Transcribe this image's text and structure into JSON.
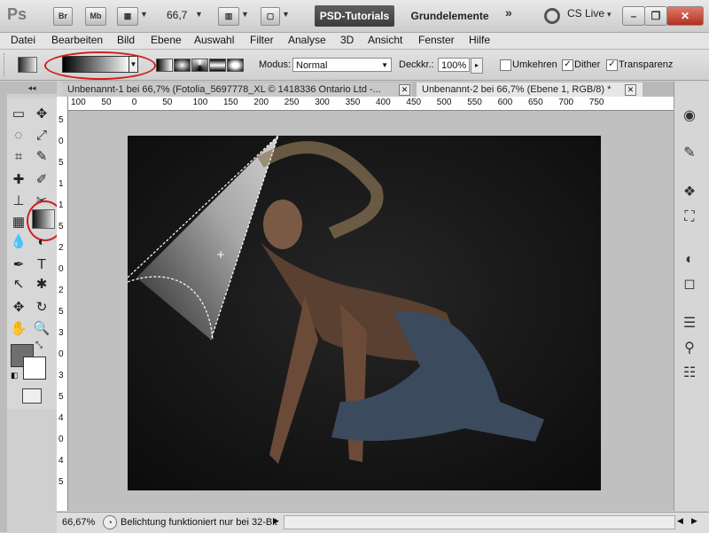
{
  "app": {
    "logo": "Ps",
    "toolbar_icons": [
      "Br",
      "Mb"
    ],
    "zoom": "66,7",
    "workspace_active": "PSD-Tutorials",
    "workspace_item": "Grundelemente",
    "more": "»",
    "cslive": "CS Live",
    "cslive_arrow": "▾"
  },
  "menu": [
    "Datei",
    "Bearbeiten",
    "Bild",
    "Ebene",
    "Auswahl",
    "Filter",
    "Analyse",
    "3D",
    "Ansicht",
    "Fenster",
    "Hilfe"
  ],
  "options": {
    "modus_label": "Modus:",
    "modus_value": "Normal",
    "deckkr_label": "Deckkr.:",
    "deckkr_value": "100%",
    "umkehren": "Umkehren",
    "dither": "Dither",
    "transparenz": "Transparenz",
    "umkehren_checked": false,
    "dither_checked": true,
    "transparenz_checked": true
  },
  "tabs": [
    {
      "title": "Unbenannt-1 bei 66,7% (Fotolia_5697778_XL © 1418336 Ontario Ltd -...",
      "active": false
    },
    {
      "title": "Unbenannt-2 bei 66,7% (Ebene 1, RGB/8) *",
      "active": true
    }
  ],
  "hruler_ticks": [
    "100",
    "50",
    "0",
    "50",
    "100",
    "150",
    "200",
    "250",
    "300",
    "350",
    "400",
    "450",
    "500",
    "550",
    "600",
    "650",
    "700",
    "750"
  ],
  "vruler_ticks": [
    "5",
    "0",
    "5",
    "1",
    "1",
    "5",
    "2",
    "0",
    "2",
    "5",
    "3",
    "0",
    "3",
    "5",
    "4",
    "0",
    "4",
    "5"
  ],
  "tools": [
    "▭",
    "✥",
    "◌",
    "⤢",
    "⌗",
    "✎",
    "✚",
    "✐",
    "⊥",
    "✂",
    "▦",
    "◐",
    "Ｔ",
    "↖",
    "✋",
    "🔍"
  ],
  "statusbar": {
    "zoom": "66,67%",
    "message": "Belichtung funktioniert nur bei 32-Bit"
  },
  "colors": {
    "foreground": "#6f6f6f",
    "background": "#ffffff",
    "highlight": "#d21e1e"
  },
  "icons": [
    "search-icon",
    "gradient-tool-icon",
    "move-tool-icon",
    "marquee-tool-icon",
    "lasso-tool-icon",
    "text-tool-icon",
    "hand-tool-icon",
    "zoom-tool-icon"
  ]
}
